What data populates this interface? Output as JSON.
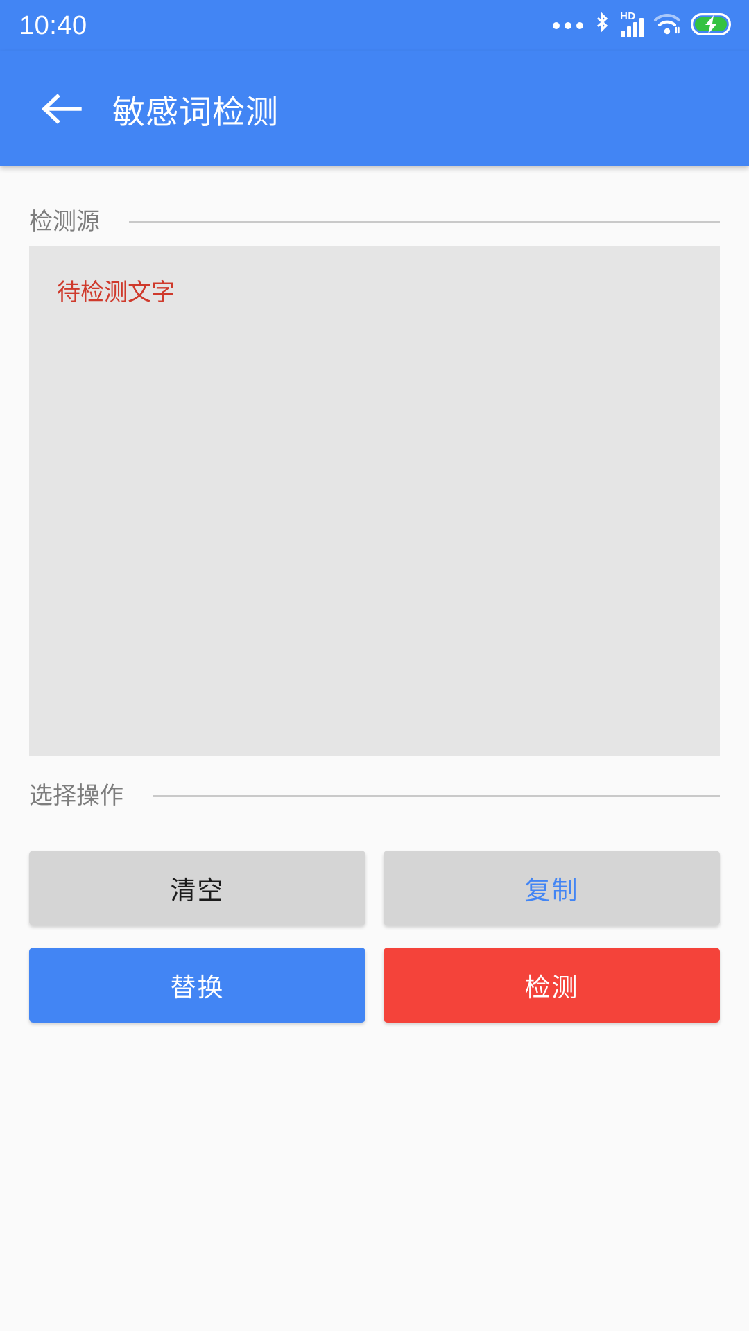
{
  "status_bar": {
    "time": "10:40",
    "icons": [
      {
        "name": "more-dots-icon"
      },
      {
        "name": "bluetooth-icon"
      },
      {
        "name": "hd-label",
        "text": "HD"
      },
      {
        "name": "cellular-signal-icon"
      },
      {
        "name": "wifi-icon"
      },
      {
        "name": "battery-charging-icon"
      }
    ],
    "background_color": "#4285f4"
  },
  "app_bar": {
    "back_icon": "arrow-left-icon",
    "title": "敏感词检测",
    "background_color": "#4285f4"
  },
  "sections": {
    "source": {
      "label": "检测源",
      "textarea_placeholder": "待检测文字",
      "textarea_value": "",
      "placeholder_color": "#cf3a2c",
      "field_background": "#e5e5e5"
    },
    "operations": {
      "label": "选择操作"
    }
  },
  "buttons": [
    {
      "name": "clear-button",
      "label": "清空",
      "style": "grey-dark",
      "bg": "#d5d5d5",
      "fg": "#1b1b1b"
    },
    {
      "name": "copy-button",
      "label": "复制",
      "style": "grey-blue",
      "bg": "#d5d5d5",
      "fg": "#4285f4"
    },
    {
      "name": "replace-button",
      "label": "替换",
      "style": "blue",
      "bg": "#4285f4",
      "fg": "#ffffff"
    },
    {
      "name": "detect-button",
      "label": "检测",
      "style": "red",
      "bg": "#f4433a",
      "fg": "#ffffff"
    }
  ],
  "page": {
    "background_color": "#fafafa",
    "divider_color": "#c9c9c9",
    "section_label_color": "#7d7d7d"
  }
}
